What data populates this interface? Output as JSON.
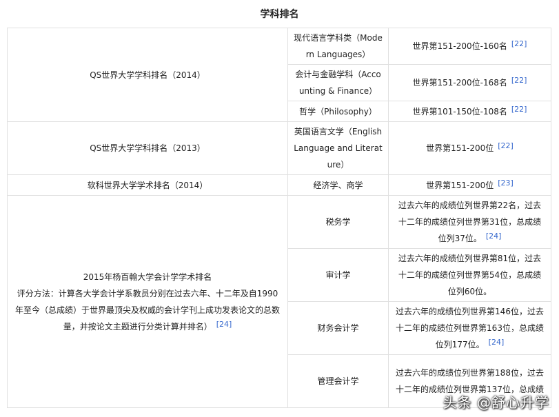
{
  "caption": "学科排名",
  "rows": {
    "qs2014": {
      "label": "QS世界大学学科排名（2014）",
      "items": [
        {
          "subject": "现代语言学科类（Modern Languages）",
          "rank": "世界第151-200位-160名",
          "ref": "[22]"
        },
        {
          "subject": "会计与金融学科（Accounting & Finance）",
          "rank": "世界第151-200位-168名",
          "ref": "[22]"
        },
        {
          "subject": "哲学（Philosophy）",
          "rank": "世界第101-150位-108名",
          "ref": "[22]"
        }
      ]
    },
    "qs2013": {
      "label": "QS世界大学学科排名（2013）",
      "subject": "英国语言文学（English Language and Literature）",
      "rank": "世界第151-200位",
      "ref": "[22]"
    },
    "shanghai2014": {
      "label": "软科世界大学学术排名（2014）",
      "subject": "经济学、商学",
      "rank": "世界第151-200位",
      "ref": "[23]"
    },
    "byu2015": {
      "title": "2015年杨百翰大学会计学学术排名",
      "method": "评分方法：计算各大学会计学系教员分别在过去六年、十二年及自1990年至今（总成绩）于世界最顶尖及权威的会计学刊上成功发表论文的总数量，并按论文主题进行分类计算并排名）",
      "ref": "[24]",
      "items": [
        {
          "subject": "税务学",
          "rank": "过去六年的成绩位列世界第22名，过去十二年的成绩位列世界第31位，总成绩位列37位。",
          "ref": "[24]"
        },
        {
          "subject": "审计学",
          "rank": "过去六年的成绩位列世界第81位，过去十二年的成绩位列世界第54位，总成绩位列60位。",
          "ref": ""
        },
        {
          "subject": "财务会计学",
          "rank": "过去六年的成绩位列世界第146位，过去十二年的成绩位列世界第163位，总成绩位列177位。",
          "ref": "[24]"
        },
        {
          "subject": "管理会计学",
          "rank": "过去六年的成绩位列世界第188位，过去十二年的成绩位列世界第137位，总成绩",
          "ref": ""
        }
      ]
    }
  },
  "watermark": "头条 @舒心升学"
}
